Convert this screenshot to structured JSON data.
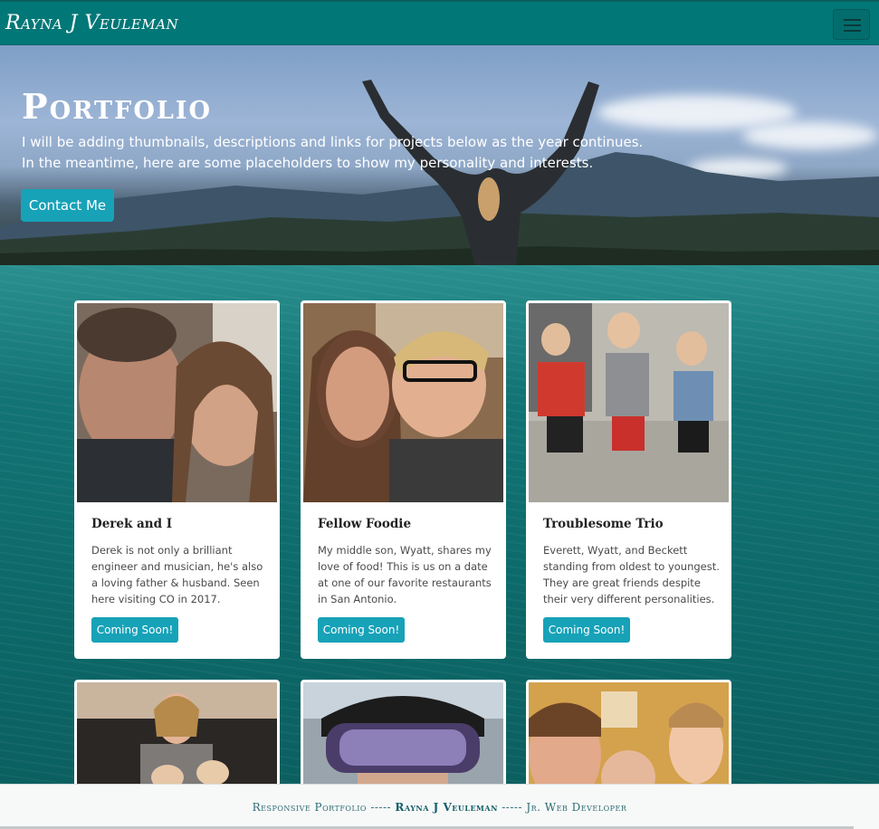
{
  "navbar": {
    "brand": "Rayna J Veuleman",
    "menu_icon": "hamburger-menu-icon"
  },
  "hero": {
    "title": "Portfolio",
    "line1": "I will be adding thumbnails, descriptions and links for projects below as the year continues.",
    "line2": "In the meantime, here are some placeholders to show my personality and interests.",
    "button": "Contact Me"
  },
  "cards": [
    {
      "title": "Derek and I",
      "text": "Derek is not only a brilliant engineer and musician, he's also a loving father & husband. Seen here visiting CO in 2017.",
      "button": "Coming Soon!"
    },
    {
      "title": "Fellow Foodie",
      "text": "My middle son, Wyatt, shares my love of food! This is us on a date at one of our favorite restaurants in San Antonio.",
      "button": "Coming Soon!"
    },
    {
      "title": "Troublesome Trio",
      "text": "Everett, Wyatt, and Beckett standing from oldest to youngest. They are great friends despite their very different personalities.",
      "button": "Coming Soon!"
    }
  ],
  "footer": {
    "left": "Responsive Portfolio",
    "sep1": " ----- ",
    "name": "Rayna J Veuleman",
    "sep2": " ----- ",
    "right": "Jr. Web Developer"
  },
  "colors": {
    "navbar": "#027777",
    "button": "#17a2b8",
    "water": "#0d6a6a",
    "footer_text": "#2c6b73"
  }
}
